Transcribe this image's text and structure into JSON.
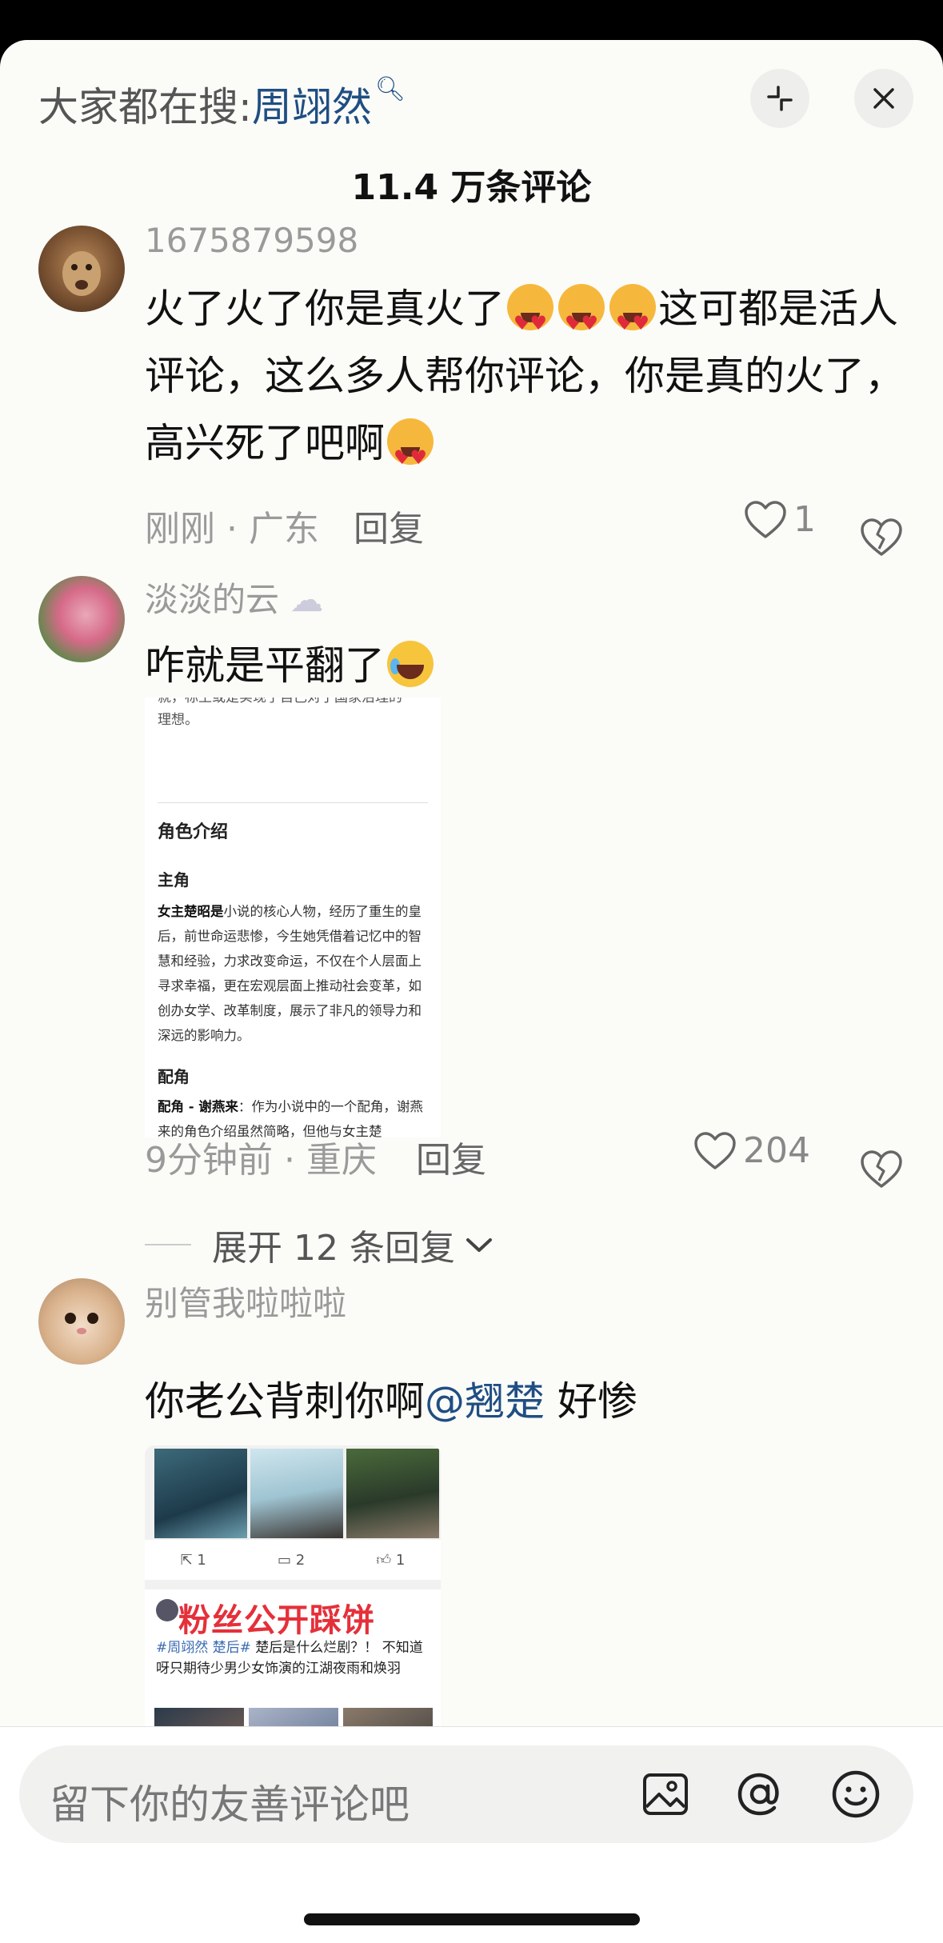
{
  "header": {
    "search_prefix": "大家都在搜:",
    "search_keyword": "周翊然",
    "comment_count": "11.4 万条评论"
  },
  "comments": [
    {
      "username": "1675879598",
      "text_a": "火了火了你是真火了",
      "text_b": "这可都是活人评论，这么多人帮你评论，你是真的火了，高兴死了吧啊",
      "time_loc": "刚刚 · 广东",
      "reply": "回复",
      "likes": "1"
    },
    {
      "username": "淡淡的云",
      "text": "咋就是平翻了",
      "time_loc": "9分钟前 · 重庆",
      "reply": "回复",
      "likes": "204",
      "image": {
        "cut_top": "就，标王或是实现了自己对于国家治理的",
        "cut_line2": "理想。",
        "heading": "角色介绍",
        "lead": "主角",
        "lead_name": "女主楚昭是",
        "lead_desc": "小说的核心人物，经历了重生的皇后，前世命运悲惨，今生她凭借着记忆中的智慧和经验，力求改变命运，不仅在个人层面上寻求幸福，更在宏观层面上推动社会变革，如创办女学、改革制度，展示了非凡的领导力和深远的影响力。",
        "support": "配角",
        "support_name": "配角 - 谢燕来",
        "support_desc": "：作为小说中的一个配角，谢燕来的角色介绍虽然简略，但他与女主楚"
      },
      "expand": "展开 12 条回复"
    },
    {
      "username": "别管我啦啦啦",
      "text_a": "你老公背刺你啊",
      "mention": "@翘楚",
      "text_b": " 好惨",
      "image": {
        "share_count": "1",
        "comment_count": "2",
        "like_count": "1",
        "overlay": "粉丝公开踩饼",
        "post_tags": "#周翊然 楚后#",
        "post_text": " 楚后是什么烂剧？！ 不知道呀只期待少男少女饰演的江湖夜雨和焕羽"
      }
    }
  ],
  "input": {
    "placeholder": "留下你的友善评论吧"
  },
  "colors": {
    "link": "#1f4e82",
    "sheet_bg": "#fbfbf8",
    "meta_gray": "#9a9a9a"
  }
}
